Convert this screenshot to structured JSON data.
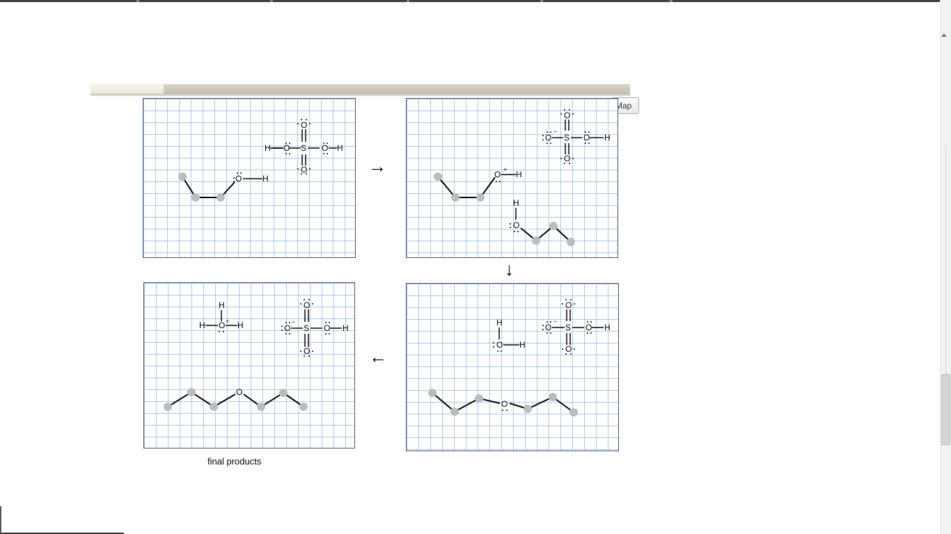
{
  "app": {
    "map_button_label": "Map"
  },
  "diagram": {
    "caption": "final products",
    "arrows": {
      "step1": "→",
      "step2": "↓",
      "step3": "←"
    },
    "atoms": {
      "O": "O",
      "S": "S",
      "H": "H",
      "plus": "+",
      "minus": "−"
    }
  }
}
